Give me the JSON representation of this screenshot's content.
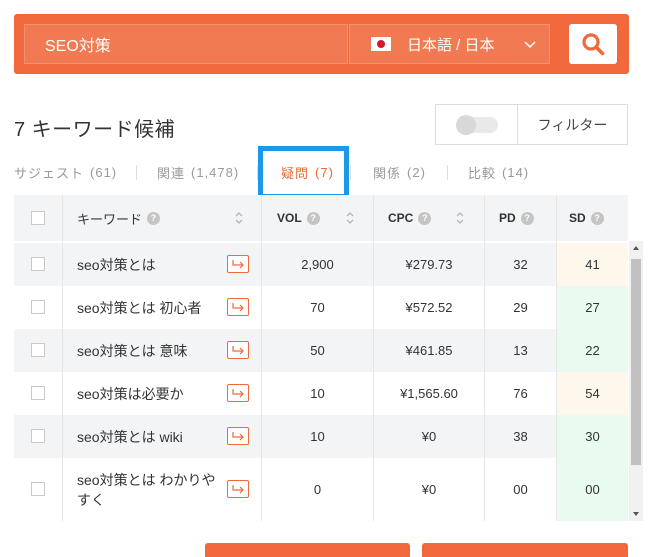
{
  "colors": {
    "accent": "#f0683b",
    "highlight_border": "#1a99e6",
    "sd_low": "#e9fbef",
    "sd_mid": "#fef8ec"
  },
  "search": {
    "query": "SEO対策",
    "language": "日本語 / 日本",
    "flag_icon": "japan-flag-icon",
    "button_icon": "search-icon"
  },
  "header": {
    "count_title": "7 キーワード候補",
    "filter_label": "フィルター"
  },
  "tabs": [
    {
      "label": "サジェスト",
      "count": "(61)"
    },
    {
      "label": "関連",
      "count": "(1,478)"
    },
    {
      "label": "疑問",
      "count": "(7)"
    },
    {
      "label": "関係",
      "count": "(2)"
    },
    {
      "label": "比較",
      "count": "(14)"
    }
  ],
  "active_tab": "疑問",
  "table": {
    "columns": {
      "keyword": "キーワード",
      "vol": "VOL",
      "cpc": "CPC",
      "pd": "PD",
      "sd": "SD"
    },
    "rows": [
      {
        "keyword": "seo対策とは",
        "vol": "2,900",
        "cpc": "¥279.73",
        "pd": "32",
        "sd": "41"
      },
      {
        "keyword": "seo対策とは 初心者",
        "vol": "70",
        "cpc": "¥572.52",
        "pd": "29",
        "sd": "27"
      },
      {
        "keyword": "seo対策とは 意味",
        "vol": "50",
        "cpc": "¥461.85",
        "pd": "13",
        "sd": "22"
      },
      {
        "keyword": "seo対策は必要か",
        "vol": "10",
        "cpc": "¥1,565.60",
        "pd": "76",
        "sd": "54"
      },
      {
        "keyword": "seo対策とは wiki",
        "vol": "10",
        "cpc": "¥0",
        "pd": "38",
        "sd": "30"
      },
      {
        "keyword": "seo対策とは わかりやすく",
        "vol": "0",
        "cpc": "¥0",
        "pd": "00",
        "sd": "00"
      }
    ]
  }
}
